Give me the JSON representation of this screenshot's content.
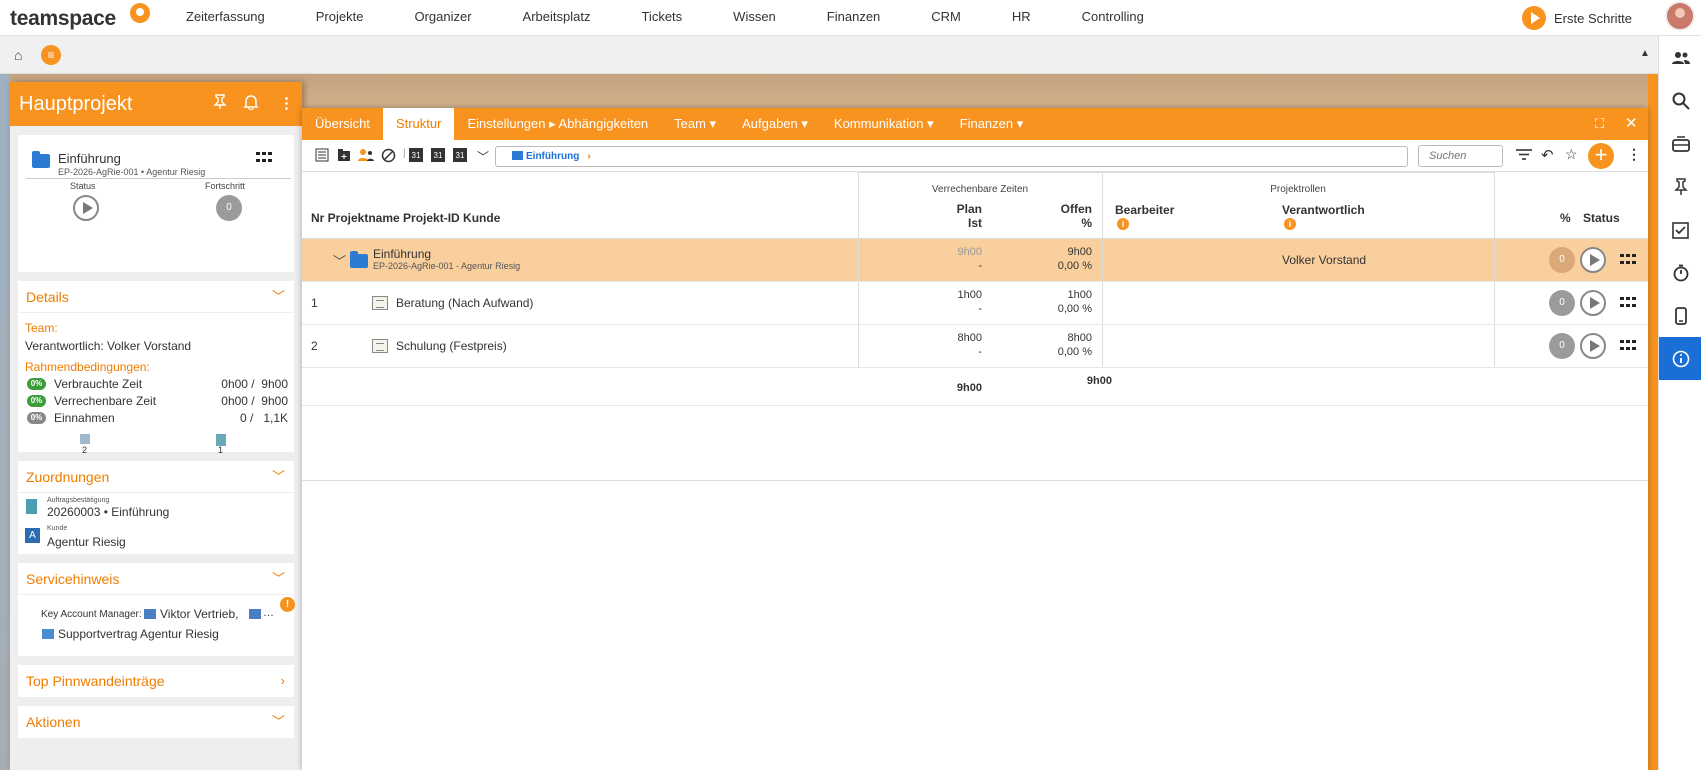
{
  "topbar": {
    "logo": "teamspace",
    "nav": [
      "Zeiterfassung",
      "Projekte",
      "Organizer",
      "Arbeitsplatz",
      "Tickets",
      "Wissen",
      "Finanzen",
      "CRM",
      "HR",
      "Controlling"
    ],
    "erste_schritte": "Erste Schritte"
  },
  "subbar": {
    "menu_glyph": "≡"
  },
  "rail": {
    "icons": [
      "users-icon",
      "search-icon",
      "inbox-icon",
      "pin-icon",
      "checklist-icon",
      "stopwatch-icon",
      "mobile-icon",
      "info-icon"
    ]
  },
  "left_panel": {
    "title": "Hauptprojekt",
    "summary": {
      "name": "Einführung",
      "sub": "EP-2026-AgRie-001 • Agentur Riesig",
      "status_label": "Status",
      "progress_label": "Fortschritt",
      "progress_value": "0"
    },
    "details": {
      "heading": "Details",
      "team_label": "Team:",
      "responsible": "Verantwortlich: Volker Vorstand",
      "rahmen_label": "Rahmendbedingungen:",
      "rows": [
        {
          "badge": "0%",
          "badge_color": "#3a9d3a",
          "label": "Verbrauchte Zeit",
          "value": "0h00 /  9h00"
        },
        {
          "badge": "0%",
          "badge_color": "#3a9d3a",
          "label": "Verrechenbare Zeit",
          "value": "0h00 /  9h00"
        },
        {
          "badge": "0%",
          "badge_color": "#888888",
          "label": "Einnahmen",
          "value": "0 /   1,1K"
        }
      ],
      "count_a": "2",
      "count_b": "1"
    },
    "zuordnungen": {
      "heading": "Zuordnungen",
      "items": [
        {
          "small": "Auftragsbestätigung",
          "value": "20260003 • Einführung"
        },
        {
          "small": "Kunde",
          "value": "Agentur Riesig"
        }
      ]
    },
    "servicehinweis": {
      "heading": "Servicehinweis",
      "kam_label": "Key Account Manager:",
      "kam_value": "Viktor Vertrieb,",
      "ellipsis": "…",
      "alert": "!",
      "contract": "Supportvertrag Agentur Riesig"
    },
    "pinnwand": {
      "heading": "Top Pinnwandeinträge"
    },
    "aktionen": {
      "heading": "Aktionen"
    }
  },
  "main": {
    "tabs": [
      "Übersicht",
      "Struktur",
      "Einstellungen ▸ Abhängigkeiten",
      "Team ▾",
      "Aufgaben ▾",
      "Kommunikation ▾",
      "Finanzen ▾"
    ],
    "active_tab": "Struktur",
    "breadcrumb": "Einführung",
    "search_placeholder": "Suchen",
    "calendar_day": "31",
    "table": {
      "head_left": "Nr Projektname Projekt-ID Kunde",
      "group_times": "Verrechenbare Zeiten",
      "plan": "Plan",
      "ist": "Ist",
      "offen": "Offen",
      "percent": "%",
      "group_roles": "Projektrollen",
      "bearbeiter": "Bearbeiter",
      "verantwortlich": "Verantwortlich",
      "pct_col": "%",
      "status_col": "Status",
      "rows": [
        {
          "nr": "",
          "name": "Einführung",
          "sub": "EP-2026-AgRie-001 - Agentur Riesig",
          "plan": "9h00",
          "ist": "-",
          "offen": "9h00",
          "pct": "0,00 %",
          "verantwortlich": "Volker Vorstand",
          "progress": "0",
          "highlight": true
        },
        {
          "nr": "1",
          "name": "Beratung (Nach Aufwand)",
          "sub": "",
          "plan": "1h00",
          "ist": "-",
          "offen": "1h00",
          "pct": "0,00 %",
          "verantwortlich": "",
          "progress": "0",
          "highlight": false
        },
        {
          "nr": "2",
          "name": "Schulung (Festpreis)",
          "sub": "",
          "plan": "8h00",
          "ist": "-",
          "offen": "8h00",
          "pct": "0,00 %",
          "verantwortlich": "",
          "progress": "0",
          "highlight": false
        }
      ],
      "total_plan": "9h00",
      "total_offen": "9h00"
    }
  }
}
